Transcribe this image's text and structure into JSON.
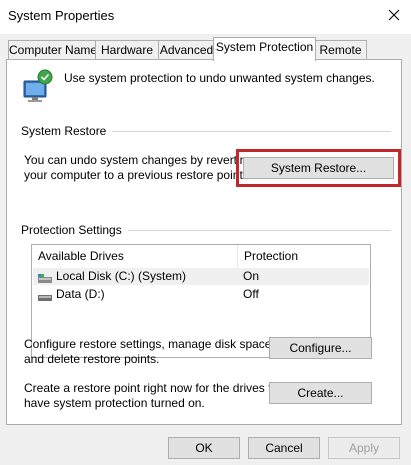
{
  "window": {
    "title": "System Properties"
  },
  "tabs": [
    {
      "label": "Computer Name"
    },
    {
      "label": "Hardware"
    },
    {
      "label": "Advanced"
    },
    {
      "label": "System Protection"
    },
    {
      "label": "Remote"
    }
  ],
  "active_tab": "System Protection",
  "intro": {
    "text": "Use system protection to undo unwanted system changes.",
    "icon": "system-protection-shield-icon"
  },
  "system_restore": {
    "group_label": "System Restore",
    "desc_line1": "You can undo system changes by reverting",
    "desc_line2": "your computer to a previous restore point.",
    "button_label": "System Restore...",
    "highlight_color": "#c1272d"
  },
  "protection_settings": {
    "group_label": "Protection Settings",
    "columns": [
      "Available Drives",
      "Protection"
    ],
    "drives": [
      {
        "name": "Local Disk (C:) (System)",
        "protection": "On",
        "icon": "system-drive-icon",
        "selected": true
      },
      {
        "name": "Data (D:)",
        "protection": "Off",
        "icon": "drive-icon",
        "selected": false
      }
    ],
    "configure_line1": "Configure restore settings, manage disk space,",
    "configure_line2": "and delete restore points.",
    "configure_button": "Configure...",
    "create_line1": "Create a restore point right now for the drives that",
    "create_line2": "have system protection turned on.",
    "create_button": "Create..."
  },
  "footer": {
    "ok": "OK",
    "cancel": "Cancel",
    "apply": "Apply"
  }
}
